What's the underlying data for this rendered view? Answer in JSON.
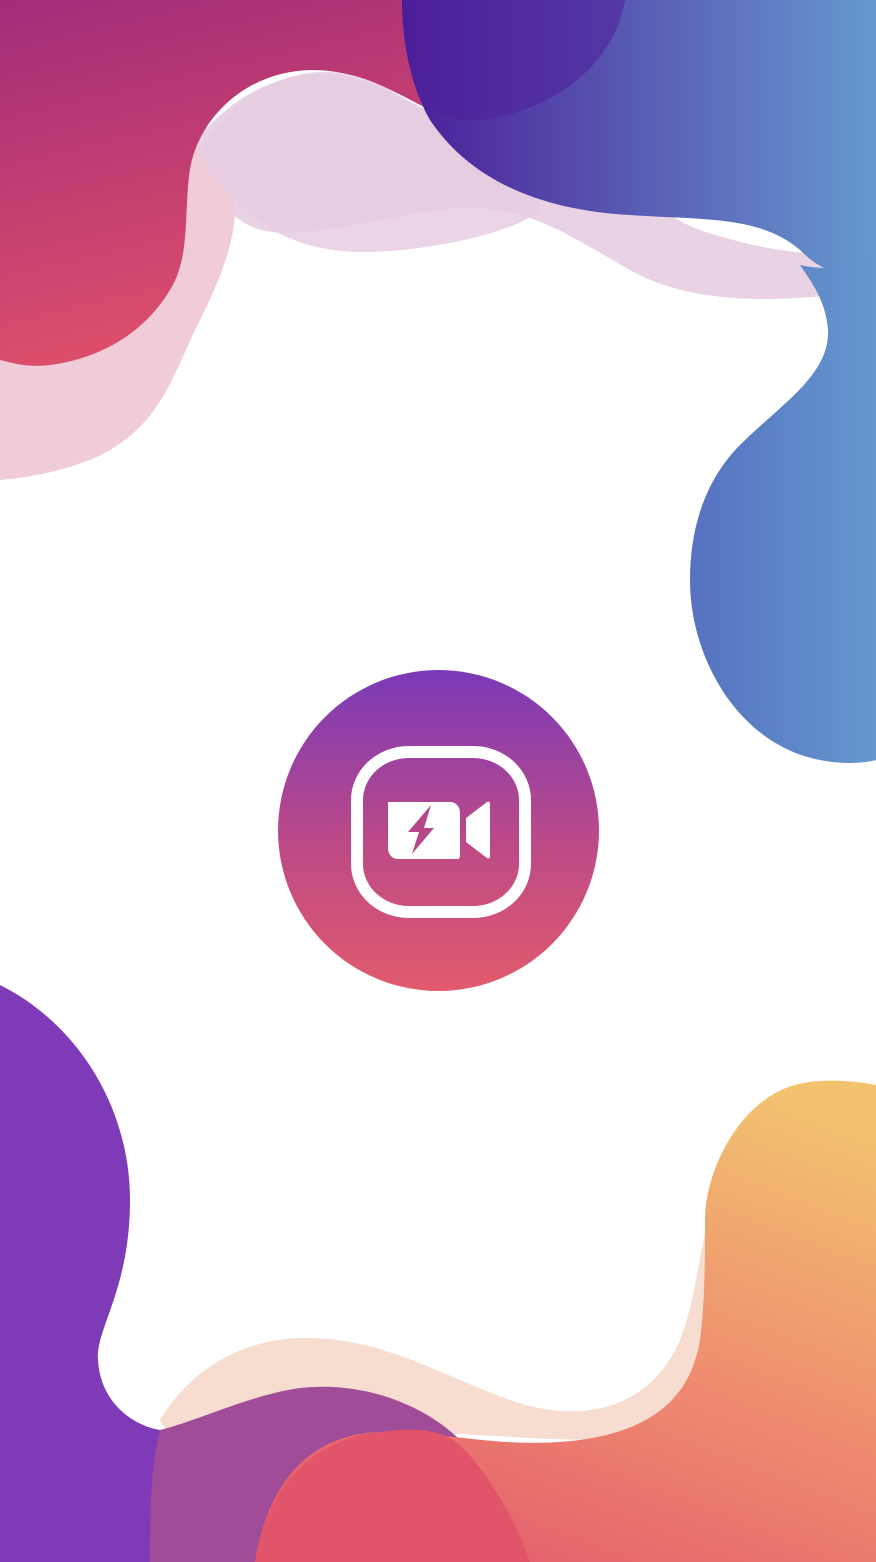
{
  "screen": {
    "type": "splash-screen",
    "app_name": ""
  },
  "logo": {
    "icon": "video-camera-flash-icon",
    "gradient_top": "#7B3AB8",
    "gradient_bottom": "#E25A6C"
  },
  "colors": {
    "background": "#FFFFFF",
    "top_left_blob": "#B2306F",
    "top_right_blob": "#4B2DA0",
    "right_blob": "#6494CC",
    "bottom_left_blob": "#7C3AB7",
    "bottom_right_blob": "#F2BF6E",
    "accent_pink": "#E35470"
  }
}
